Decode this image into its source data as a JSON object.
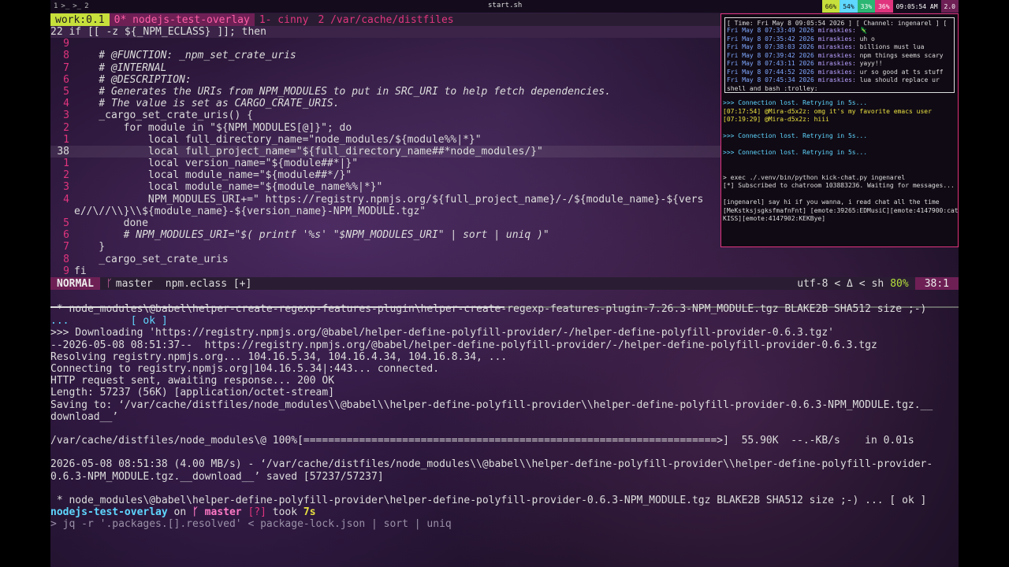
{
  "topbar": {
    "workspaces": [
      "1",
      ">_",
      ">_",
      "2"
    ],
    "window_title": "start.sh",
    "stats": [
      {
        "label": "66%",
        "color": "#c7e03b"
      },
      {
        "label": "54%",
        "color": "#5fd7ff"
      },
      {
        "label": "33%",
        "color": "#2bb673"
      },
      {
        "label": "36%",
        "color": "#e0357e"
      },
      {
        "label": "09:05:54 AM",
        "color": "#140c1c"
      },
      {
        "label": "2.0",
        "color": "#6e2055"
      }
    ]
  },
  "tmux": {
    "session": "work:0.1",
    "tabs": [
      {
        "label": "0*  nodejs-test-overlay",
        "active": true
      },
      {
        "label": "1-  cinny",
        "active": false
      },
      {
        "label": "2  /var/cache/distfiles",
        "active": false
      }
    ]
  },
  "vim": {
    "first_line": "22 if [[ -z ${_NPM_ECLASS} ]]; then",
    "lines": [
      {
        "num": "9",
        "text": ""
      },
      {
        "num": "8",
        "text": "    # @FUNCTION: _npm_set_crate_uris",
        "type": "cmt"
      },
      {
        "num": "7",
        "text": "    # @INTERNAL",
        "type": "cmt"
      },
      {
        "num": "6",
        "text": "    # @DESCRIPTION:",
        "type": "cmt"
      },
      {
        "num": "5",
        "text": "    # Generates the URIs from NPM_MODULES to put in SRC_URI to help fetch dependencies.",
        "type": "cmt"
      },
      {
        "num": "4",
        "text": "    # The value is set as CARGO_CRATE_URIS.",
        "type": "cmt"
      },
      {
        "num": "3",
        "text": "    _cargo_set_crate_uris() {",
        "type": "fn"
      },
      {
        "num": "2",
        "text": "        for module in \"${NPM_MODULES[@]}\"; do",
        "type": "code"
      },
      {
        "num": "1",
        "text": "            local full_directory_name=\"node_modules/${module%%|*}\"",
        "type": "code"
      },
      {
        "num": "38",
        "text": "            local full_project_name=\"${full_directory_name##*node_modules/}\"",
        "type": "code",
        "current": true
      },
      {
        "num": "1",
        "text": "            local version_name=\"${module##*|}\"",
        "type": "code"
      },
      {
        "num": "2",
        "text": "            local module_name=\"${module##*/}\"",
        "type": "code"
      },
      {
        "num": "3",
        "text": "            local module_name=\"${module_name%%|*}\"",
        "type": "code"
      },
      {
        "num": "4",
        "text": "            NPM_MODULES_URI+=\" https://registry.npmjs.org/${full_project_name}/-/${module_name}-${vers",
        "type": "code"
      },
      {
        "num": "",
        "text": "e//\\//\\\\}\\\\${module_name}-${version_name}-NPM_MODULE.tgz\"",
        "type": "code"
      },
      {
        "num": "5",
        "text": "        done",
        "type": "code"
      },
      {
        "num": "6",
        "text": "        # NPM_MODULES_URI=\"$( printf '%s' \"$NPM_MODULES_URI\" | sort | uniq )\"",
        "type": "cmt"
      },
      {
        "num": "7",
        "text": "    }",
        "type": "code"
      },
      {
        "num": "8",
        "text": "    _cargo_set_crate_uris",
        "type": "code"
      },
      {
        "num": "9",
        "text": "fi",
        "type": "code"
      }
    ]
  },
  "statusline": {
    "mode": "NORMAL",
    "branch": "master",
    "filename": "npm.eclass [+]",
    "encoding": "utf-8",
    "filetype": "sh",
    "percent": "80%",
    "position": "38:1"
  },
  "chat": {
    "header": "[ Time: Fri May  8 09:05:54 2026 ] [ Channel: ingenarel ] [",
    "messages": [
      {
        "ts": "Fri May  8 07:33:49 2026",
        "user": "miraskies:",
        "text": "🦎"
      },
      {
        "ts": "Fri May  8 07:35:42 2026",
        "user": "miraskies:",
        "text": "uh o"
      },
      {
        "ts": "Fri May  8 07:38:03 2026",
        "user": "miraskies:",
        "text": "billions must lua"
      },
      {
        "ts": "Fri May  8 07:39:42 2026",
        "user": "miraskies:",
        "text": "npm things seems scary"
      },
      {
        "ts": "Fri May  8 07:43:11 2026",
        "user": "miraskies:",
        "text": "yayy!!"
      },
      {
        "ts": "Fri May  8 07:44:52 2026",
        "user": "miraskies:",
        "text": "ur so good at ts stuff"
      },
      {
        "ts": "Fri May  8 07:45:34 2026",
        "user": "miraskies:",
        "text": "lua should replace ur"
      },
      {
        "ts": "",
        "user": "",
        "text": "shell and bash :trolley:"
      }
    ],
    "lower": [
      {
        "text": ">>> Connection lost. Retrying in 5s...",
        "type": "retry"
      },
      {
        "text": "[07:17:54] @Mira-d5x2z: omg it's my favorite emacs user",
        "type": "mira"
      },
      {
        "text": "[07:19:29] @Mira-d5x2z: hiii",
        "type": "mira"
      },
      {
        "text": "",
        "type": "plain"
      },
      {
        "text": ">>> Connection lost. Retrying in 5s...",
        "type": "retry"
      },
      {
        "text": "",
        "type": "plain"
      },
      {
        "text": ">>> Connection lost. Retrying in 5s...",
        "type": "retry"
      },
      {
        "text": "",
        "type": "plain"
      },
      {
        "text": "",
        "type": "plain"
      },
      {
        "text": "> exec ./.venv/bin/python kick-chat.py ingenarel",
        "type": "plain"
      },
      {
        "text": "[*] Subscribed to chatroom 103883236. Waiting for messages...",
        "type": "plain"
      },
      {
        "text": "",
        "type": "plain"
      },
      {
        "text": "[ingenarel] say hi if you wanna, i read chat all the time",
        "type": "plain"
      },
      {
        "text": "[MeKstksjsgksfmafnFnt] [emote:39265:EDMusiC][emote:4147900:cat",
        "type": "plain"
      },
      {
        "text": "KISS][emote:4147902:KEKBye]",
        "type": "plain"
      }
    ]
  },
  "shell": {
    "lines": [
      {
        "text": " * node_modules\\@babel\\helper-create-regexp-features-plugin\\helper-create-regexp-features-plugin-7.26.3-NPM_MODULE.tgz BLAKE2B SHA512 size ;-)",
        "type": "star"
      },
      {
        "text": "...          [ ok ]",
        "type": "ok"
      },
      {
        "text": ">>> Downloading 'https://registry.npmjs.org/@babel/helper-define-polyfill-provider/-/helper-define-polyfill-provider-0.6.3.tgz'",
        "type": "plain"
      },
      {
        "text": "--2026-05-08 08:51:37--  https://registry.npmjs.org/@babel/helper-define-polyfill-provider/-/helper-define-polyfill-provider-0.6.3.tgz",
        "type": "plain"
      },
      {
        "text": "Resolving registry.npmjs.org... 104.16.5.34, 104.16.4.34, 104.16.8.34, ...",
        "type": "plain"
      },
      {
        "text": "Connecting to registry.npmjs.org|104.16.5.34|:443... connected.",
        "type": "plain"
      },
      {
        "text": "HTTP request sent, awaiting response... 200 OK",
        "type": "plain"
      },
      {
        "text": "Length: 57237 (56K) [application/octet-stream]",
        "type": "plain"
      },
      {
        "text": "Saving to: ‘/var/cache/distfiles/node_modules\\\\@babel\\\\helper-define-polyfill-provider\\\\helper-define-polyfill-provider-0.6.3-NPM_MODULE.tgz.__",
        "type": "plain"
      },
      {
        "text": "download__’",
        "type": "plain"
      },
      {
        "text": "",
        "type": "plain"
      },
      {
        "text": "/var/cache/distfiles/node_modules\\@ 100%[===================================================================>]  55.90K  --.-KB/s    in 0.01s",
        "type": "plain"
      },
      {
        "text": "",
        "type": "plain"
      },
      {
        "text": "2026-05-08 08:51:38 (4.00 MB/s) - ‘/var/cache/distfiles/node_modules\\\\@babel\\\\helper-define-polyfill-provider\\\\helper-define-polyfill-provider-",
        "type": "plain"
      },
      {
        "text": "0.6.3-NPM_MODULE.tgz.__download__’ saved [57237/57237]",
        "type": "plain"
      },
      {
        "text": "",
        "type": "plain"
      },
      {
        "text": " * node_modules\\@babel\\helper-define-polyfill-provider\\helper-define-polyfill-provider-0.6.3-NPM_MODULE.tgz BLAKE2B SHA512 size ;-) ... [ ok ]",
        "type": "star"
      }
    ],
    "prompt": {
      "dir": "nodejs-test-overlay",
      "on": "on",
      "branch_icon": "ᚴ",
      "branch": "master",
      "status": "[?]",
      "took": "took",
      "duration": "7s"
    },
    "command": "> jq -r '.packages.[].resolved' < package-lock.json | sort | uniq"
  },
  "colors": {
    "accent": "#e0357e",
    "green": "#b7e03b",
    "cyan": "#5fd7ff",
    "mode_bg": "#6e2055"
  }
}
